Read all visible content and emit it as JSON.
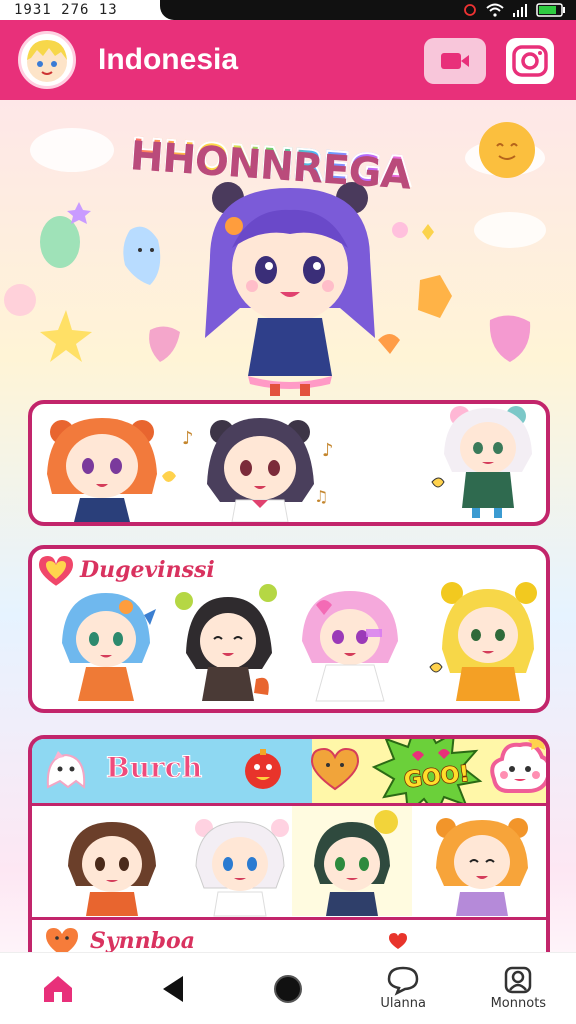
{
  "status_bar": {
    "time": "1931 276 13"
  },
  "header": {
    "title": "Indonesia"
  },
  "hero": {
    "title": "HHONNREGA"
  },
  "sections": [
    {
      "title": ""
    },
    {
      "title": "Dugevinssi"
    },
    {
      "title": "Burch",
      "badge": "GOO!"
    }
  ],
  "footer_section": {
    "title": "Synnboa"
  },
  "nav": {
    "item4_label": "Ulanna",
    "item5_label": "Monnots"
  },
  "colors": {
    "accent": "#e8307a",
    "card_border": "#c2256b",
    "title_pink": "#d9325f"
  },
  "icons": [
    "avatar-icon",
    "video-icon",
    "camera-icon",
    "home-icon",
    "back-icon",
    "circle-icon",
    "chat-icon",
    "profile-icon"
  ]
}
